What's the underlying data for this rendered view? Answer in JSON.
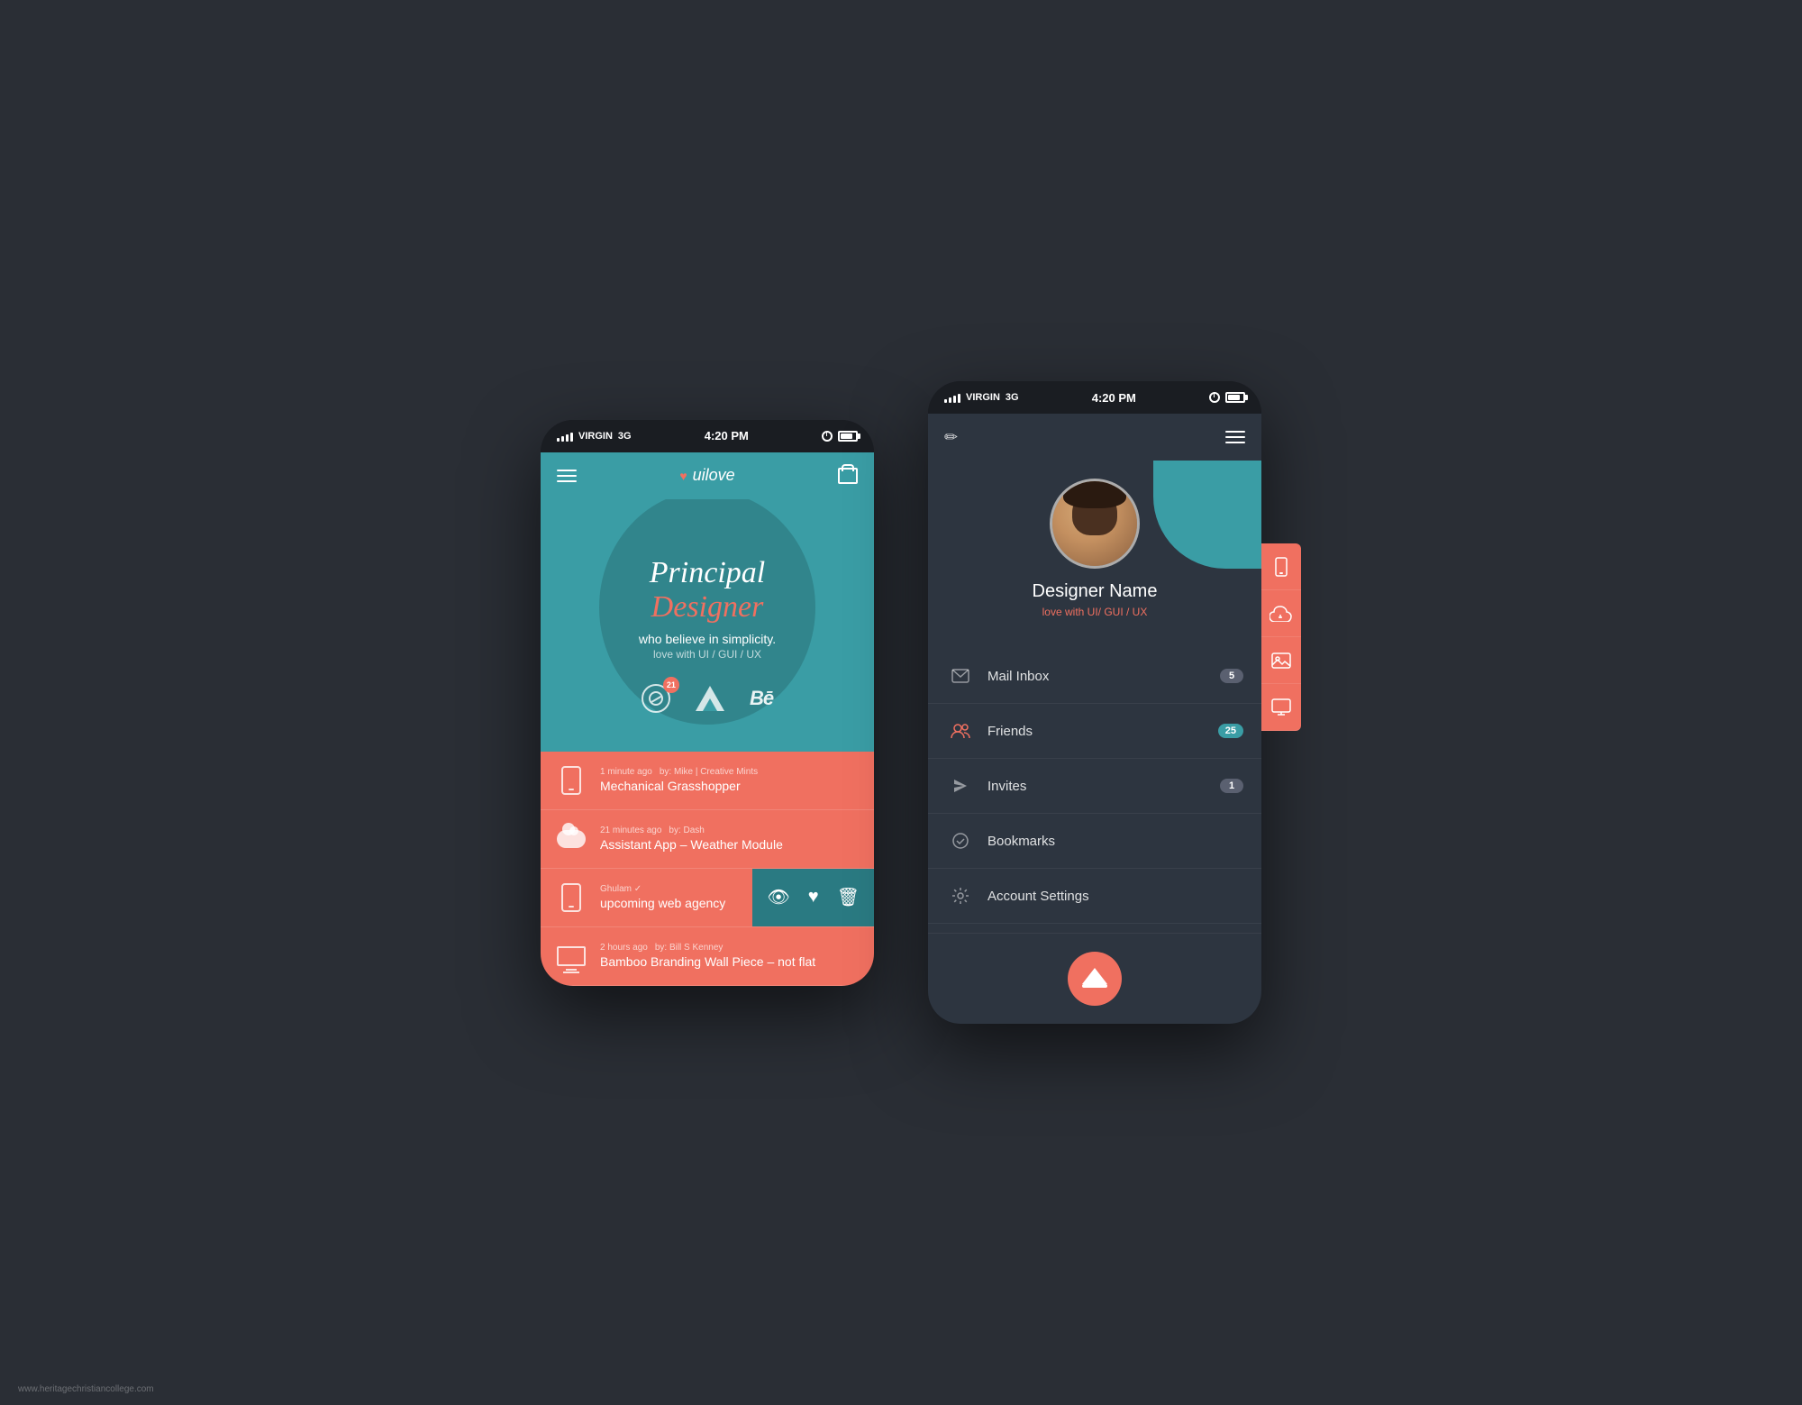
{
  "app": {
    "title": "uilove",
    "watermark": "www.heritagechristiancollege.com"
  },
  "phone1": {
    "status": {
      "carrier": "VIRGIN",
      "network": "3G",
      "time": "4:20 PM"
    },
    "header": {
      "logo": "uilove"
    },
    "hero": {
      "line1": "Principal",
      "line2": "Designer",
      "subtitle1": "who believe in simplicity.",
      "subtitle2": "love with UI / GUI / UX",
      "badge_count": "21"
    },
    "feed": [
      {
        "time": "1 minute ago",
        "author": "by: Mike | Creative Mints",
        "title": "Mechanical Grasshopper",
        "icon": "mobile"
      },
      {
        "time": "21 minutes ago",
        "author": "by: Dash",
        "title": "Assistant App – Weather Module",
        "icon": "cloud"
      },
      {
        "time": "",
        "author": "Ghulam ✓",
        "title": "upcoming web agency",
        "icon": "mobile",
        "has_actions": true
      },
      {
        "time": "2 hours ago",
        "author": "by: Bill S Kenney",
        "title": "Bamboo Branding Wall Piece – not flat",
        "icon": "monitor"
      }
    ]
  },
  "phone2": {
    "status": {
      "carrier": "VIRGIN",
      "network": "3G",
      "time": "4:20 PM"
    },
    "profile": {
      "name": "Designer Name",
      "tagline": "love with UI/ GUI / UX"
    },
    "menu": [
      {
        "label": "Mail Inbox",
        "icon": "mail",
        "badge": "5",
        "badge_type": "normal"
      },
      {
        "label": "Friends",
        "icon": "friends",
        "badge": "25",
        "badge_type": "teal"
      },
      {
        "label": "Invites",
        "icon": "invites",
        "badge": "1",
        "badge_type": "normal"
      },
      {
        "label": "Bookmarks",
        "icon": "bookmarks",
        "badge": "",
        "badge_type": ""
      },
      {
        "label": "Account Settings",
        "icon": "settings",
        "badge": "",
        "badge_type": ""
      }
    ]
  }
}
